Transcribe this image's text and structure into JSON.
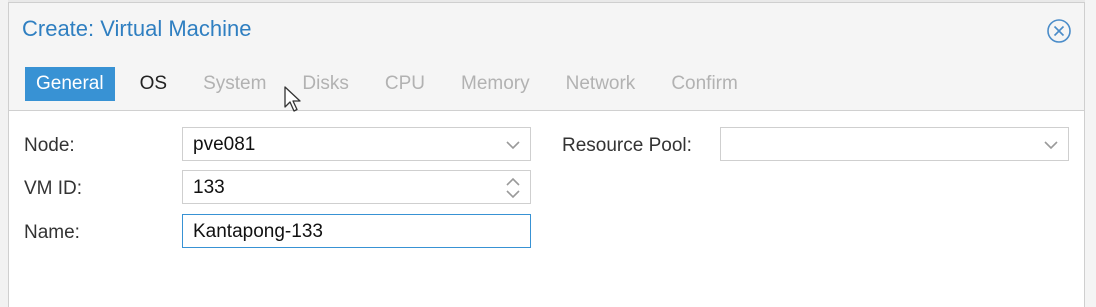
{
  "dialog": {
    "title": "Create: Virtual Machine"
  },
  "tabs": [
    {
      "label": "General",
      "state": "active"
    },
    {
      "label": "OS",
      "state": "enabled"
    },
    {
      "label": "System",
      "state": "disabled"
    },
    {
      "label": "Disks",
      "state": "disabled"
    },
    {
      "label": "CPU",
      "state": "disabled"
    },
    {
      "label": "Memory",
      "state": "disabled"
    },
    {
      "label": "Network",
      "state": "disabled"
    },
    {
      "label": "Confirm",
      "state": "disabled"
    }
  ],
  "form": {
    "node": {
      "label": "Node:",
      "value": "pve081"
    },
    "vmid": {
      "label": "VM ID:",
      "value": "133"
    },
    "name": {
      "label": "Name:",
      "value": "Kantapong-133"
    },
    "pool": {
      "label": "Resource Pool:",
      "value": ""
    }
  },
  "colors": {
    "accent": "#3892d4",
    "title": "#2f7fc1"
  },
  "icons": {
    "close": "close-circle-icon",
    "dropdown": "chevron-down-icon",
    "spinner": "spinner-up-down-icon",
    "cursor": "mouse-pointer-icon"
  }
}
